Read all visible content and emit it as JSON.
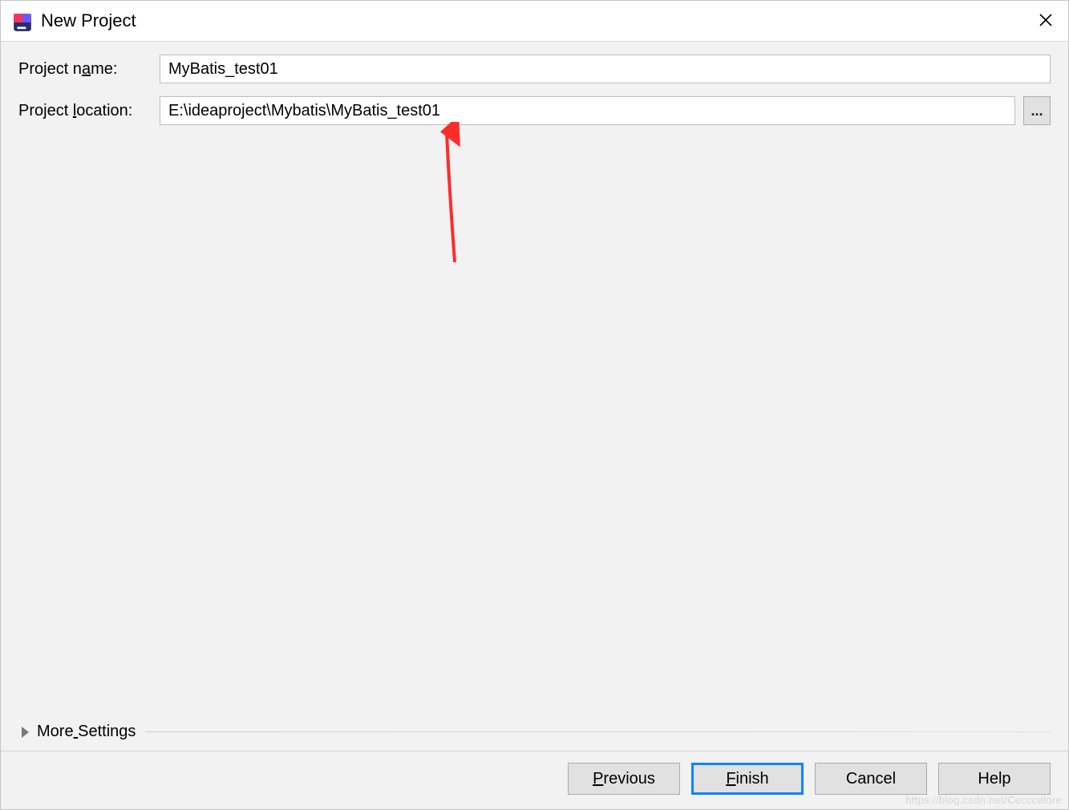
{
  "window": {
    "title": "New Project"
  },
  "form": {
    "project_name_label_pre": "Project n",
    "project_name_label_mnemonic": "a",
    "project_name_label_post": "me:",
    "project_name_value": "MyBatis_test01",
    "project_location_label_pre": "Project ",
    "project_location_label_mnemonic": "l",
    "project_location_label_post": "ocation:",
    "project_location_value": "E:\\ideaproject\\Mybatis\\MyBatis_test01",
    "browse_label": "..."
  },
  "more": {
    "pre": "More",
    "mnemonic": " ",
    "post": "Settings"
  },
  "buttons": {
    "previous_mnemonic": "P",
    "previous_rest": "revious",
    "finish_mnemonic": "F",
    "finish_rest": "inish",
    "cancel": "Cancel",
    "help": "Help"
  },
  "watermark": "https://blog.csdn.net/Cecccelore"
}
